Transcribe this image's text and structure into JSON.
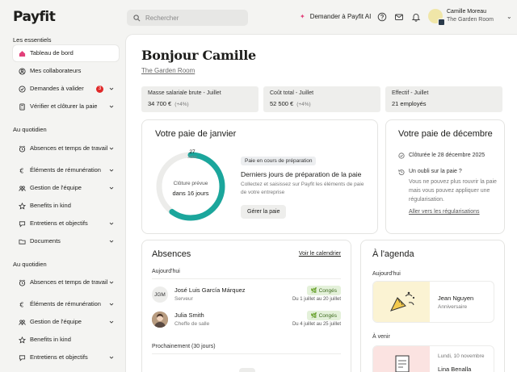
{
  "app": {
    "logo": "Payfit"
  },
  "header": {
    "search_placeholder": "Rechercher",
    "ask_label": "Demander à Payfit AI",
    "user_name": "Camille Moreau",
    "user_company": "The Garden Room"
  },
  "sidebar": {
    "section1_title": "Les essentiels",
    "section1": [
      {
        "label": "Tableau de bord",
        "icon": "home-icon"
      },
      {
        "label": "Mes collaborateurs",
        "icon": "users-icon"
      },
      {
        "label": "Demandes à valider",
        "icon": "check-circle-icon",
        "count": "3"
      },
      {
        "label": "Vérifier et clôturer la paie",
        "icon": "calculator-icon"
      }
    ],
    "section2_title": "Au quotidien",
    "section2": [
      {
        "label": "Absences et temps de travail",
        "icon": "alarm-clock-icon"
      },
      {
        "label": "Éléments de rémunération",
        "icon": "euro-icon"
      },
      {
        "label": "Gestion de l'équipe",
        "icon": "team-icon"
      },
      {
        "label": "Benefits in kind",
        "icon": "star-icon"
      },
      {
        "label": "Entretiens et objectifs",
        "icon": "chat-icon"
      },
      {
        "label": "Documents",
        "icon": "folder-icon"
      }
    ],
    "section3_title": "Au quotidien",
    "section3": [
      {
        "label": "Absences et temps de travail",
        "icon": "alarm-clock-icon"
      },
      {
        "label": "Éléments de rémunération",
        "icon": "euro-icon"
      },
      {
        "label": "Gestion de l'équipe",
        "icon": "team-icon"
      },
      {
        "label": "Benefits in kind",
        "icon": "star-icon"
      },
      {
        "label": "Entretiens et objectifs",
        "icon": "chat-icon"
      }
    ]
  },
  "main": {
    "greeting": "Bonjour Camille",
    "company": "The Garden Room",
    "stats": [
      {
        "title": "Masse salariale brute - Juillet",
        "value": "34 700 €",
        "delta": "(+4%)"
      },
      {
        "title": "Coût total - Juillet",
        "value": "52 500 €",
        "delta": "(+4%)"
      },
      {
        "title": "Effectif - Juillet",
        "value": "21 employés",
        "delta": ""
      }
    ],
    "pay_jan": {
      "title": "Votre paie de janvier",
      "day": "27",
      "month": "Janv",
      "donut_caption": "Clôture prévue",
      "donut_value": "dans 16 jours",
      "progress": 0.6,
      "tag": "Paie en cours de préparation",
      "heading": "Derniers jours de préparation de la paie",
      "desc": "Collectez et saisissez sur Payfit les éléments de paie de votre entreprise",
      "button": "Gérer la paie"
    },
    "pay_dec": {
      "title": "Votre paie de décembre",
      "closed": "Clôturée le 28 décembre 2025",
      "forgot_title": "Un oubli sur la paie ?",
      "forgot_desc": "Vous ne pouvez plus rouvrir la paie mais vous pouvez appliquer une régularisation.",
      "link": "Aller vers les régularisations"
    },
    "absences": {
      "title": "Absences",
      "calendar_link": "Voir le calendrier",
      "today_label": "Aujourd'hui",
      "people": [
        {
          "initials": "JGM",
          "name": "José Luis García Márquez",
          "role": "Serveur",
          "type": "Congés",
          "dates": "Du 1 juillet au 20 juillet"
        },
        {
          "initials": "",
          "name": "Julia Smith",
          "role": "Cheffe de salle",
          "type": "Congés",
          "dates": "Du 4 juillet au 25 juillet"
        }
      ],
      "upcoming_label": "Prochainement (30 jours)"
    },
    "agenda": {
      "title": "À l'agenda",
      "today_label": "Aujourd'hui",
      "today_item": {
        "name": "Jean Nguyen",
        "sub": "Anniversaire"
      },
      "upcoming_label": "À venir",
      "upcoming_item": {
        "date": "Lundi, 10 novembre",
        "name": "Lina Benalla"
      }
    }
  },
  "colors": {
    "accent": "#1ba69c",
    "danger": "#e02929",
    "conges_bg": "#e4f1da"
  }
}
